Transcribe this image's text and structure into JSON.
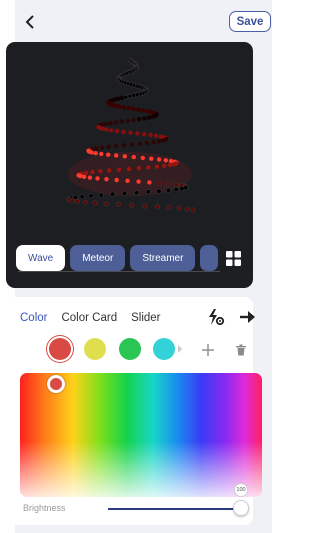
{
  "header": {
    "back_icon": "chevron-left-icon",
    "save_label": "Save"
  },
  "preview": {
    "background": "#1d1e22"
  },
  "effects": {
    "items": [
      {
        "label": "Wave",
        "active": true
      },
      {
        "label": "Meteor",
        "active": false
      },
      {
        "label": "Streamer",
        "active": false
      }
    ],
    "grid_icon": "grid-icon"
  },
  "color_panel": {
    "tabs": [
      {
        "label": "Color",
        "active": true
      },
      {
        "label": "Color Card",
        "active": false
      },
      {
        "label": "Slider",
        "active": false
      }
    ],
    "tool_icons": [
      "flash-settings-icon",
      "arrow-right-icon"
    ],
    "swatches": [
      "#d84a43",
      "#dede4e",
      "#29c654",
      "#33d1d8"
    ],
    "add_icon": "plus-icon",
    "delete_icon": "trash-icon",
    "selected_color": "#d84a43",
    "brightness": {
      "label": "Brightness",
      "value": "100",
      "level": 1.0
    }
  }
}
